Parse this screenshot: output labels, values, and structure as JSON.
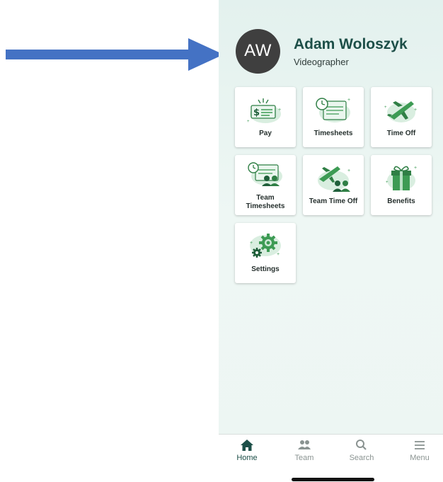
{
  "profile": {
    "initials": "AW",
    "name": "Adam Woloszyk",
    "role": "Videographer"
  },
  "tiles": [
    {
      "label": "Pay",
      "icon": "pay-icon"
    },
    {
      "label": "Timesheets",
      "icon": "timesheets-icon"
    },
    {
      "label": "Time Off",
      "icon": "time-off-icon"
    },
    {
      "label": "Team\nTimesheets",
      "icon": "team-timesheets-icon"
    },
    {
      "label": "Team Time Off",
      "icon": "team-time-off-icon"
    },
    {
      "label": "Benefits",
      "icon": "benefits-icon"
    },
    {
      "label": "Settings",
      "icon": "settings-icon"
    }
  ],
  "nav": [
    {
      "label": "Home",
      "icon": "home-icon",
      "active": true
    },
    {
      "label": "Team",
      "icon": "team-icon",
      "active": false
    },
    {
      "label": "Search",
      "icon": "search-icon",
      "active": false
    },
    {
      "label": "Menu",
      "icon": "menu-icon",
      "active": false
    }
  ],
  "colors": {
    "arrow": "#4472c4",
    "brand_dark": "#1d4f48",
    "icon_green": "#3d9b54",
    "icon_light": "#cfe9d8",
    "avatar_bg": "#3f3f3f",
    "nav_inactive": "#8a9391"
  }
}
